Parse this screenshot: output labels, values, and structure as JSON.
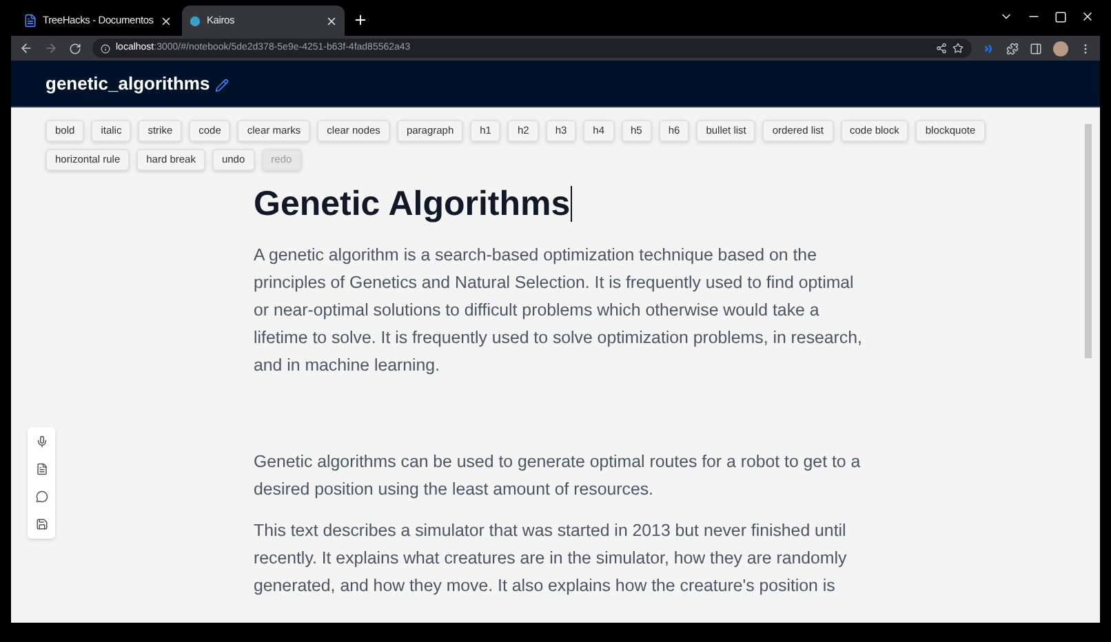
{
  "browser": {
    "tabs": [
      {
        "title": "TreeHacks - Documentos",
        "selected": false,
        "kind": "doc"
      },
      {
        "title": "Kairos",
        "selected": true,
        "kind": "app"
      }
    ],
    "address": {
      "host": "localhost",
      "path": ":3000/#/notebook/5de2d378-5e9e-4251-b63f-4fad85562a43"
    }
  },
  "header": {
    "title": "genetic_algorithms"
  },
  "toolbar": [
    {
      "label": "bold",
      "disabled": false
    },
    {
      "label": "italic",
      "disabled": false
    },
    {
      "label": "strike",
      "disabled": false
    },
    {
      "label": "code",
      "disabled": false
    },
    {
      "label": "clear marks",
      "disabled": false
    },
    {
      "label": "clear nodes",
      "disabled": false
    },
    {
      "label": "paragraph",
      "disabled": false
    },
    {
      "label": "h1",
      "disabled": false
    },
    {
      "label": "h2",
      "disabled": false
    },
    {
      "label": "h3",
      "disabled": false
    },
    {
      "label": "h4",
      "disabled": false
    },
    {
      "label": "h5",
      "disabled": false
    },
    {
      "label": "h6",
      "disabled": false
    },
    {
      "label": "bullet list",
      "disabled": false
    },
    {
      "label": "ordered list",
      "disabled": false
    },
    {
      "label": "code block",
      "disabled": false
    },
    {
      "label": "blockquote",
      "disabled": false
    },
    {
      "label": "horizontal rule",
      "disabled": false
    },
    {
      "label": "hard break",
      "disabled": false
    },
    {
      "label": "undo",
      "disabled": false
    },
    {
      "label": "redo",
      "disabled": true
    }
  ],
  "document": {
    "heading": "Genetic Algorithms",
    "paragraphs": [
      "A genetic algorithm is a search-based optimization technique based on the principles of Genetics and Natural Selection. It is frequently used to find optimal or near-optimal solutions to difficult problems which otherwise would take a lifetime to solve. It is frequently used to solve optimization problems, in research, and in machine learning.",
      "Genetic algorithms can be used to generate optimal routes for a robot to get to a desired position using the least amount of resources.",
      "This text describes a simulator that was started in 2013 but never finished until recently. It explains what creatures are in the simulator, how they are randomly generated, and how they move. It also explains how the creature's position is"
    ]
  }
}
